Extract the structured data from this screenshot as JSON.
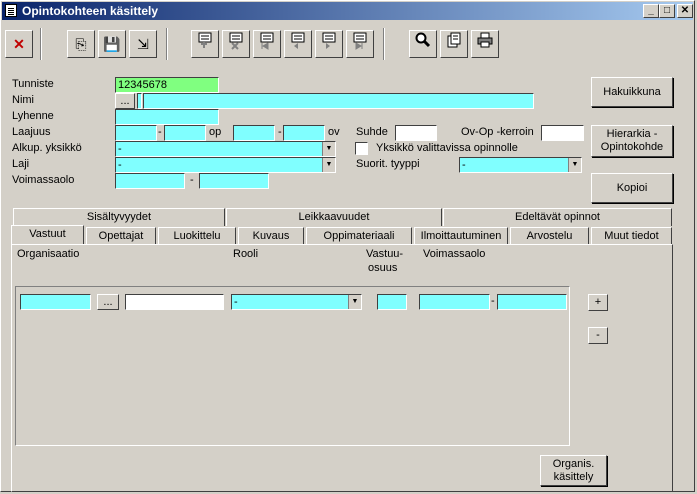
{
  "window": {
    "title": "Opintokohteen käsittely"
  },
  "caption_buttons": {
    "minimize": "_",
    "maximize": "□",
    "close": "✕"
  },
  "toolbar": {
    "delete": "✕",
    "copy": "⎘",
    "save": "💾",
    "exit": "⇲",
    "search": "🔍",
    "notes": "📄",
    "print": "🖶"
  },
  "form": {
    "tunniste_label": "Tunniste",
    "tunniste_value": "12345678",
    "nimi_label": "Nimi",
    "nimi_button": "...",
    "lyhenne_label": "Lyhenne",
    "laajuus_label": "Laajuus",
    "laajuus_dash1": "-",
    "laajuus_op": "op",
    "laajuus_dash2": "-",
    "laajuus_ov": "ov",
    "alkup_label": "Alkup. yksikkö",
    "alkup_value": "-",
    "laji_label": "Laji",
    "laji_value": "-",
    "voimassaolo_label": "Voimassaolo",
    "voimassaolo_dash": "-",
    "suhde_label": "Suhde",
    "ovop_label": "Ov-Op -kerroin",
    "yksikko_label": "Yksikkö valittavissa opinnolle",
    "suorit_label": "Suorit. tyyppi",
    "suorit_value": "-"
  },
  "side_buttons": {
    "hakuikkuna": "Hakuikkuna",
    "hierarkia_line1": "Hierarkia -",
    "hierarkia_line2": "Opintokohde",
    "kopioi": "Kopioi"
  },
  "tabs_row1": [
    "Sisältyvyydet",
    "Leikkaavuudet",
    "Edeltävät opinnot"
  ],
  "tabs_row2": [
    "Vastuut",
    "Opettajat",
    "Luokittelu",
    "Kuvaus",
    "Oppimateriaali",
    "Ilmoittautuminen",
    "Arvostelu",
    "Muut tiedot"
  ],
  "vastuut": {
    "col_organisaatio": "Organisaatio",
    "col_rooli": "Rooli",
    "col_vastuu_line1": "Vastuu-",
    "col_vastuu_line2": "osuus",
    "col_voimassaolo": "Voimassaolo",
    "org_button": "...",
    "rooli_value": "-",
    "date_dash": "-",
    "add_button": "+",
    "remove_button": "-",
    "organis_line1": "Organis.",
    "organis_line2": "käsittely"
  }
}
